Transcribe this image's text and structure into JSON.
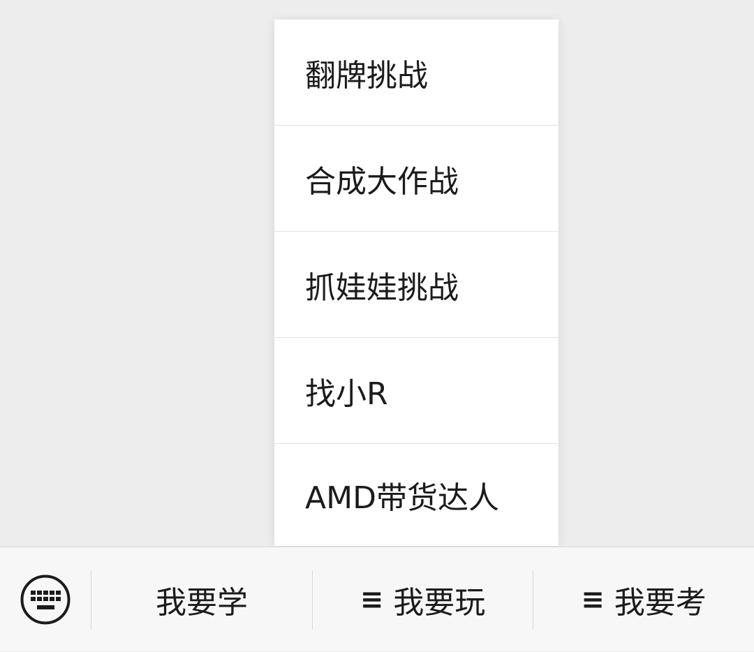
{
  "popup_menu": {
    "items": [
      {
        "label": "翻牌挑战"
      },
      {
        "label": "合成大作战"
      },
      {
        "label": "抓娃娃挑战"
      },
      {
        "label": "找小R"
      },
      {
        "label": "AMD带货达人"
      }
    ]
  },
  "bottom_bar": {
    "keyboard_icon": "keyboard-icon",
    "tabs": [
      {
        "label": "我要学",
        "has_submenu": false
      },
      {
        "label": "我要玩",
        "has_submenu": true,
        "marker": "≡"
      },
      {
        "label": "我要考",
        "has_submenu": true,
        "marker": "≡"
      }
    ]
  },
  "colors": {
    "background": "#ededed",
    "menu_background": "#ffffff",
    "bar_background": "#f7f7f7",
    "text": "#1b1b1b",
    "divider": "#d6d6d6"
  }
}
